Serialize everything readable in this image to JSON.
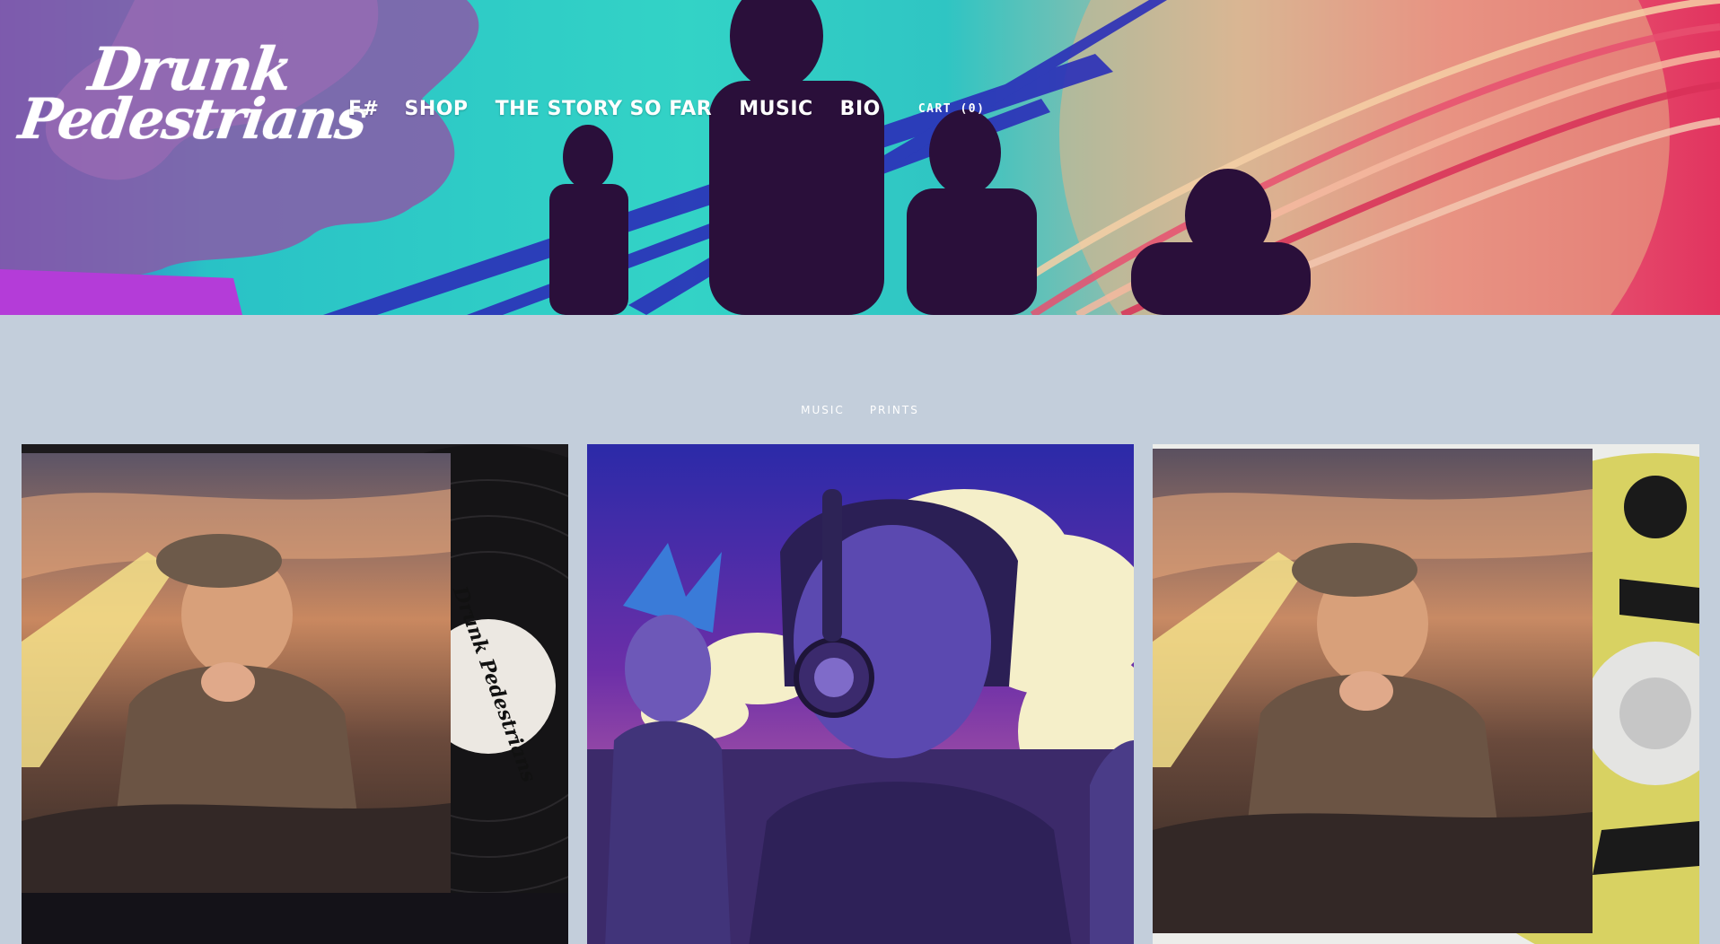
{
  "header": {
    "logo": {
      "line1": "Drunk",
      "line2": "Pedestrians"
    },
    "nav": [
      {
        "label": "F#"
      },
      {
        "label": "SHOP"
      },
      {
        "label": "THE STORY SO FAR"
      },
      {
        "label": "MUSIC"
      },
      {
        "label": "BIO"
      }
    ],
    "cart_label": "CART (0)"
  },
  "filters": [
    {
      "label": "MUSIC"
    },
    {
      "label": "PRINTS"
    }
  ],
  "products": [
    {
      "image": "vinyl-record-album-art",
      "record_label": "Drunk Pedestrians"
    },
    {
      "image": "headphones-character-illustration"
    },
    {
      "image": "cd-album-art"
    }
  ],
  "colors": {
    "page_bg": "#c3cedb",
    "hero_teal": "#2fc5c3",
    "hero_pink": "#e2345f",
    "nav_text": "#ffffff"
  }
}
